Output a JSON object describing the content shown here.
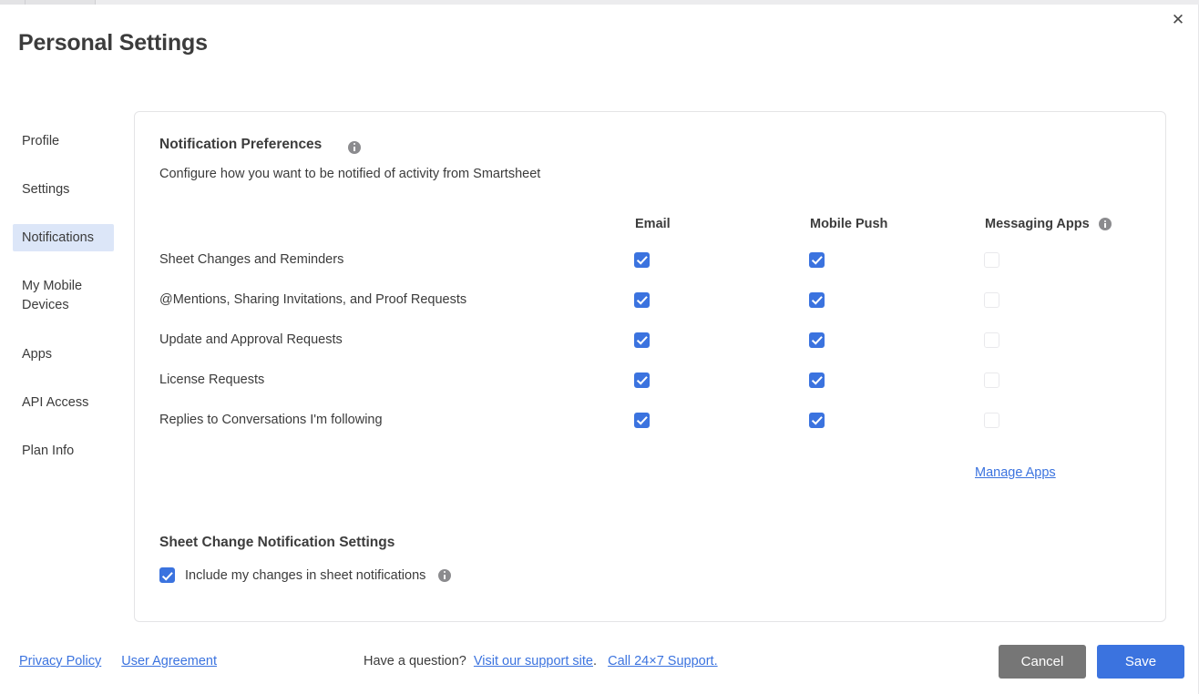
{
  "window": {
    "close_label": "✕",
    "title": "Personal Settings"
  },
  "sidebar": {
    "items": [
      {
        "label": "Profile",
        "active": false
      },
      {
        "label": "Settings",
        "active": false
      },
      {
        "label": "Notifications",
        "active": true
      },
      {
        "label": "My Mobile Devices",
        "active": false
      },
      {
        "label": "Apps",
        "active": false
      },
      {
        "label": "API Access",
        "active": false
      },
      {
        "label": "Plan Info",
        "active": false
      }
    ]
  },
  "main": {
    "section_title": "Notification Preferences",
    "section_subtitle": "Configure how you want to be notified of activity from Smartsheet",
    "columns": [
      "Email",
      "Mobile Push",
      "Messaging Apps"
    ],
    "rows": [
      {
        "label": "Sheet Changes and Reminders",
        "email": true,
        "mobile_push": true,
        "messaging_apps": false
      },
      {
        "label": "@Mentions, Sharing Invitations, and Proof Requests",
        "email": true,
        "mobile_push": true,
        "messaging_apps": false
      },
      {
        "label": "Update and Approval Requests",
        "email": true,
        "mobile_push": true,
        "messaging_apps": false
      },
      {
        "label": "License Requests",
        "email": true,
        "mobile_push": true,
        "messaging_apps": false
      },
      {
        "label": "Replies to Conversations I'm following",
        "email": true,
        "mobile_push": true,
        "messaging_apps": false
      }
    ],
    "manage_apps_label": "Manage Apps",
    "sheet_change_title": "Sheet Change Notification Settings",
    "include_changes_label": "Include my changes in sheet notifications",
    "include_changes_checked": true
  },
  "footer": {
    "privacy_policy": "Privacy Policy",
    "user_agreement": "User Agreement",
    "help_prefix": "Have a question?",
    "support_site": "Visit our support site",
    "help_period": ".",
    "call_support": "Call 24×7 Support.",
    "cancel_label": "Cancel",
    "save_label": "Save"
  },
  "colors": {
    "accent": "#3b73df",
    "cancel": "#767676",
    "active_nav_bg": "#dce6f8",
    "link": "#3b73df"
  }
}
